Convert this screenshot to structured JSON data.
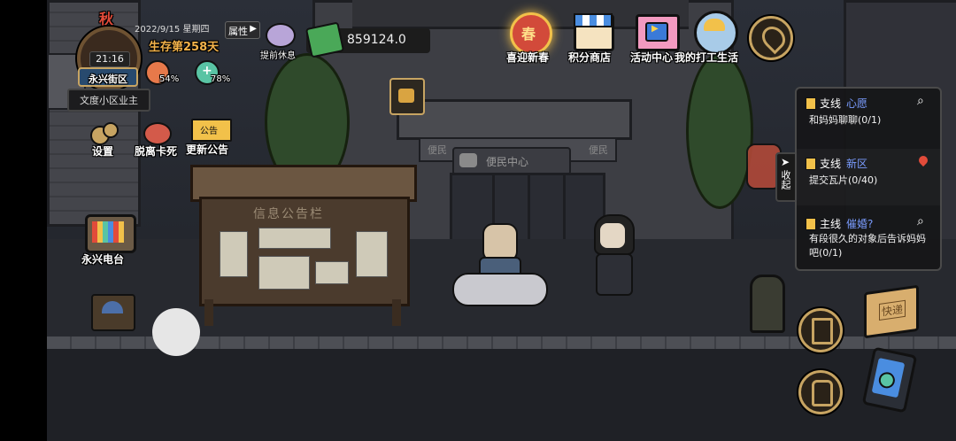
{
  "status": {
    "season": "秋",
    "clock": "21:16",
    "date": "2022/9/15 星期四",
    "survival_days": "生存第258天",
    "attr_label": "属性",
    "brand_badge": "永兴街区",
    "title_badge": "文度小区业主",
    "hunger_pct": "54%",
    "health_pct": "78%"
  },
  "top_bar": {
    "rest_label": "提前休息",
    "money": "859124.0"
  },
  "top_menu": [
    {
      "label": "喜迎新春",
      "icon": "spring-lantern-icon"
    },
    {
      "label": "积分商店",
      "icon": "shop-icon"
    },
    {
      "label": "活动中心",
      "icon": "gift-video-icon"
    },
    {
      "label": "我的打工生活",
      "icon": "worker-avatar-icon"
    }
  ],
  "left_menu": {
    "settings": "设置",
    "unstuck": "脱离卡死",
    "notice": "更新公告",
    "notice_sign": "公告",
    "radio": "永兴电台"
  },
  "world": {
    "board_title": "信息公告栏",
    "center_sign": "便民中心",
    "sign_left": "便民",
    "sign_right": "便民"
  },
  "quests": {
    "collapse_label": "收起",
    "items": [
      {
        "type": "支线",
        "name": "心愿",
        "desc": "和妈妈聊聊(0/1)",
        "icon": "search-icon"
      },
      {
        "type": "支线",
        "name": "新区",
        "desc": "提交瓦片(0/40)",
        "icon": "location-pin-icon"
      },
      {
        "type": "主线",
        "name": "催婚?",
        "desc": "有段很久的对象后告诉妈妈吧(0/1)",
        "icon": "search-icon"
      }
    ]
  },
  "right_tools": {
    "package_label": "快递",
    "quest_icon": "clipboard-icon",
    "bag_icon": "backpack-icon",
    "phone_icon": "phone-icon"
  },
  "colors": {
    "gold": "#c7a462",
    "days_orange": "#f2b24a",
    "quest_highlight": "#7a9cff"
  }
}
